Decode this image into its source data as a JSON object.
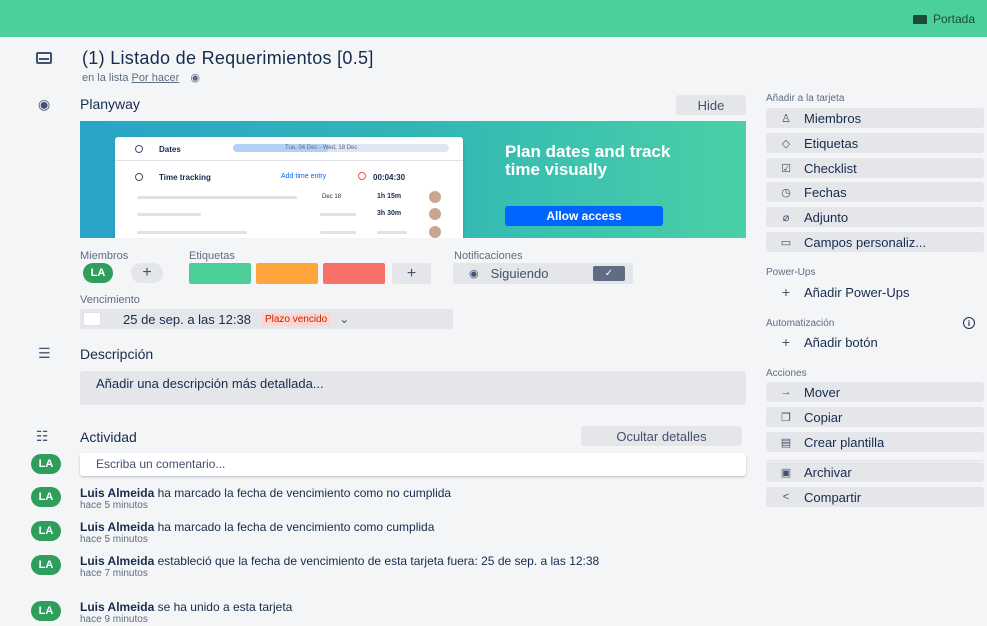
{
  "topbar": {
    "portada_label": "Portada",
    "color": "#4bd09b"
  },
  "card": {
    "title": "(1) Listado de Requerimientos [0.5]",
    "in_list_prefix": "en la lista",
    "list_name": "Por hacer"
  },
  "planyway": {
    "section_title": "Planyway",
    "hide_label": "Hide",
    "dates_label": "Dates",
    "dates_range": "Tue, 04 Dec - Wed, 18 Dec",
    "time_tracking_label": "Time tracking",
    "add_entry_label": "Add time entry",
    "timer": "00:04:30",
    "rows": [
      {
        "date": "Dec 18",
        "duration": "1h 15m"
      },
      {
        "date": "",
        "duration": "3h 30m"
      }
    ],
    "headline": "Plan dates and track time visually",
    "allow_label": "Allow access"
  },
  "details": {
    "members_label": "Miembros",
    "member_initials": "LA",
    "labels_label": "Etiquetas",
    "label_colors": [
      "#4bce97",
      "#ffa53e",
      "#f87168"
    ],
    "notifications_label": "Notificaciones",
    "following_label": "Siguiendo",
    "due_label": "Vencimiento",
    "due_value": "25 de sep. a las 12:38",
    "due_badge": "Plazo vencido"
  },
  "description": {
    "title": "Descripción",
    "placeholder": "Añadir una descripción más detallada..."
  },
  "activity": {
    "title": "Actividad",
    "toggle_label": "Ocultar detalles",
    "comment_placeholder": "Escriba un comentario...",
    "items": [
      {
        "user": "Luis Almeida",
        "text": "ha marcado la fecha de vencimiento como no cumplida",
        "time": "hace 5 minutos"
      },
      {
        "user": "Luis Almeida",
        "text": "ha marcado la fecha de vencimiento como cumplida",
        "time": "hace 5 minutos"
      },
      {
        "user": "Luis Almeida",
        "text": "estableció que la fecha de vencimiento de esta tarjeta fuera: 25 de sep. a las 12:38",
        "time": "hace 7 minutos"
      },
      {
        "user": "Luis Almeida",
        "text": "se ha unido a esta tarjeta",
        "time": "hace 9 minutos"
      }
    ]
  },
  "sidebar": {
    "add_title": "Añadir a la tarjeta",
    "add_items": [
      "Miembros",
      "Etiquetas",
      "Checklist",
      "Fechas",
      "Adjunto",
      "Campos personaliz..."
    ],
    "powerups_title": "Power-Ups",
    "add_powerups": "Añadir Power-Ups",
    "automation_title": "Automatización",
    "add_button": "Añadir botón",
    "actions_title": "Acciones",
    "actions": [
      "Mover",
      "Copiar",
      "Crear plantilla",
      "Archivar",
      "Compartir"
    ]
  }
}
